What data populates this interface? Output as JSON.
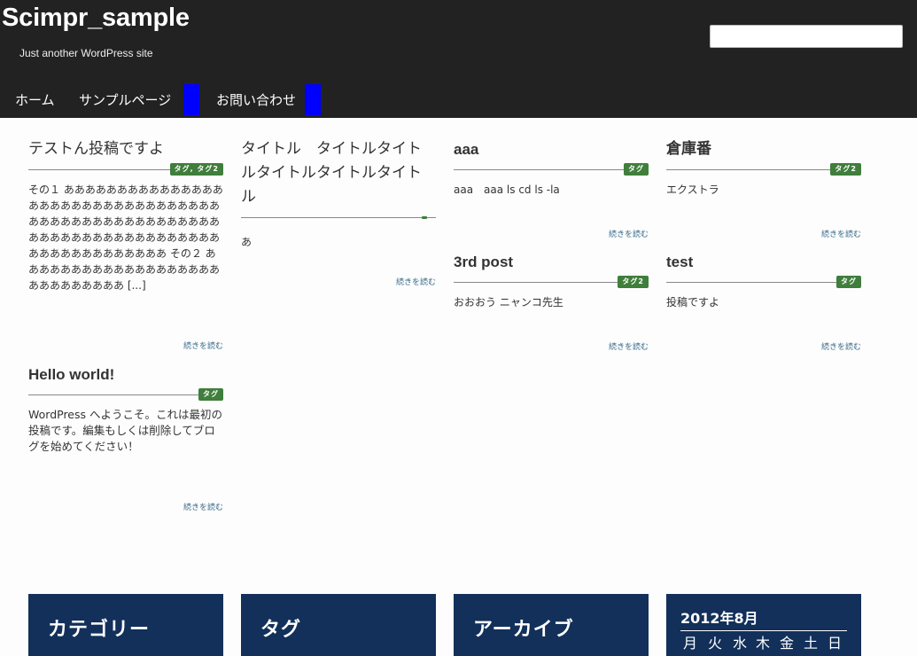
{
  "header": {
    "site_title": "Scimpr_sample",
    "site_description": "Just another WordPress site",
    "search": {
      "value": "",
      "placeholder": ""
    },
    "nav": [
      {
        "label": "ホーム"
      },
      {
        "label": "サンプルページ"
      },
      {
        "label": "お問い合わせ"
      }
    ],
    "nav_block_color": "#0000ff"
  },
  "posts": [
    {
      "title": "テストん投稿ですよ",
      "tags": "タグ, タグ2",
      "excerpt": "その１ ああああああああああああああああああああああああああああああああああああああああああああああああああああああああああああああああああああああああああああああああああ その２ ああああああああああああああああああああああああああああ [...]",
      "more": "続きを読む"
    },
    {
      "title": "タイトル　タイトルタイトルタイトルタイトルタイトル",
      "tags": "",
      "excerpt": "あ",
      "more": "続きを読む"
    },
    {
      "title": "aaa",
      "tags": "タグ",
      "excerpt": "aaa　aaa ls cd ls -la",
      "more": "続きを読む"
    },
    {
      "title": "倉庫番",
      "tags": "タグ2",
      "excerpt": "エクストラ",
      "more": "続きを読む"
    },
    {
      "title": "3rd post",
      "tags": "タグ2",
      "excerpt": "おおおう ニャンコ先生",
      "more": "続きを読む"
    },
    {
      "title": "test",
      "tags": "タグ",
      "excerpt": "投稿ですよ",
      "more": "続きを読む"
    },
    {
      "title": "Hello world!",
      "tags": "タグ",
      "excerpt": "WordPress へようこそ。これは最初の投稿です。編集もしくは削除してブログを始めてください！",
      "more": "続きを読む"
    }
  ],
  "widgets": {
    "categories_title": "カテゴリー",
    "tags_title": "タグ",
    "archives_title": "アーカイブ",
    "calendar": {
      "caption": "2012年8月",
      "days": [
        "月",
        "火",
        "水",
        "木",
        "金",
        "土",
        "日"
      ]
    }
  },
  "colors": {
    "header_bg": "#222222",
    "tag_badge": "#3f7e3b",
    "widget_bg": "#12305a",
    "more_link": "#3a6a8a"
  }
}
